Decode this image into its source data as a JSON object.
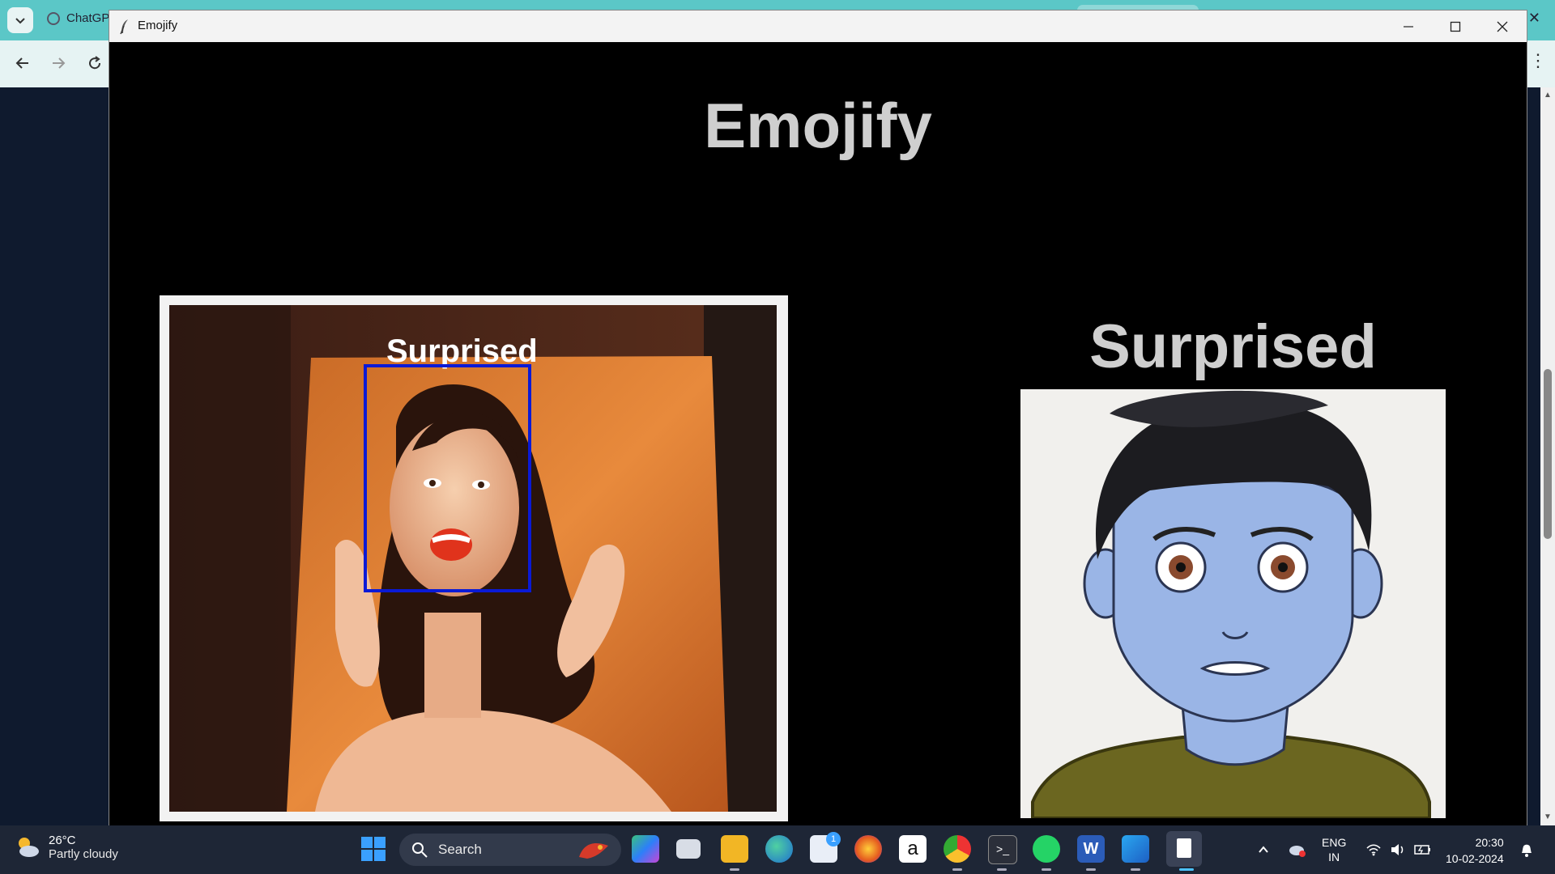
{
  "browser": {
    "tab_title": "ChatGP",
    "nav_icons": [
      "back-arrow-icon",
      "forward-arrow-icon",
      "reload-icon",
      "more-vert-icon"
    ]
  },
  "window": {
    "title": "Emojify",
    "controls": [
      "minimize-icon",
      "maximize-icon",
      "close-icon"
    ]
  },
  "app": {
    "heading": "Emojify",
    "camera_overlay_label": "Surprised",
    "emotion_label": "Surprised"
  },
  "taskbar": {
    "weather": {
      "temperature": "26°C",
      "condition": "Partly cloudy"
    },
    "search_placeholder": "Search",
    "store_badge": "1",
    "language": {
      "line1": "ENG",
      "line2": "IN"
    },
    "time": "20:30",
    "date": "10-02-2024"
  },
  "colors": {
    "browser_accent": "#5bc7c7",
    "face_box": "#0a1ad6",
    "heading_text": "#cfcfcf",
    "emoji_skin": "#9ab5e6",
    "taskbar_bg": "#1e2636"
  }
}
